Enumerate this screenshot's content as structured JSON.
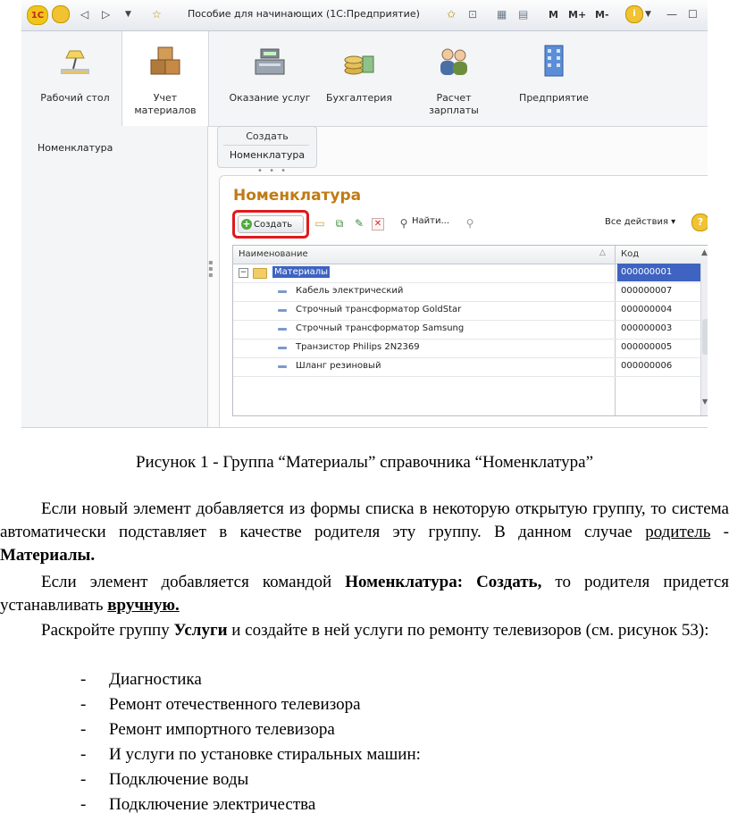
{
  "screenshot": {
    "window_title": "Пособие для начинающих (1С:Предприятие)",
    "logo_text": "1С",
    "memory_buttons": [
      "M",
      "M+",
      "M-"
    ],
    "sections": [
      {
        "label": "Рабочий стол",
        "icon": "desk-lamp-icon"
      },
      {
        "label": "Учет материалов",
        "icon": "boxes-icon"
      },
      {
        "label": "Оказание услуг",
        "icon": "cash-register-icon"
      },
      {
        "label": "Бухгалтерия",
        "icon": "coins-icon"
      },
      {
        "label": "Расчет зарплаты",
        "icon": "people-icon"
      },
      {
        "label": "Предприятие",
        "icon": "building-icon"
      }
    ],
    "left_nav": {
      "items": [
        "Номенклатура"
      ]
    },
    "actions_panel": {
      "header": "Создать",
      "item": "Номенклатура"
    },
    "form": {
      "title": "Номенклатура",
      "toolbar": {
        "create_label": "Создать",
        "find_label": "Найти...",
        "all_actions_label": "Все действия ▾"
      },
      "grid": {
        "columns": [
          "Наименование",
          "Код"
        ],
        "rows": [
          {
            "name": "Материалы",
            "code": "000000001",
            "type": "group",
            "selected": true
          },
          {
            "name": "Кабель электрический",
            "code": "000000007",
            "type": "item"
          },
          {
            "name": "Строчный трансформатор GoldStar",
            "code": "000000004",
            "type": "item"
          },
          {
            "name": "Строчный трансформатор Samsung",
            "code": "000000003",
            "type": "item"
          },
          {
            "name": "Транзистор Philips 2N2369",
            "code": "000000005",
            "type": "item"
          },
          {
            "name": "Шланг резиновый",
            "code": "000000006",
            "type": "item"
          }
        ]
      }
    },
    "colors": {
      "highlight_frame": "#e0191b",
      "selected_row": "#3e63c1",
      "form_title": "#c07b14"
    }
  },
  "document": {
    "caption": "Рисунок 1 - Группа “Материалы” справочника “Номенклатура”",
    "p1_text": "Если новый элемент добавляется из формы списка в некоторую открытую группу, то система автоматически подставляет в качестве родителя эту группу. В данном случае ",
    "p1_underlined": "родитель",
    "p1_dash": " - ",
    "p1_bold": "Материалы.",
    "p2_text": "Если элемент добавляется командой ",
    "p2_bold": "Номенклатура: Создать,",
    "p2_text2": " то родителя придется устанавливать ",
    "p2_bold_underlined": "вручную.",
    "p3_text": "Раскройте группу ",
    "p3_bold": "Услуги",
    "p3_text2": " и создайте в ней услуги по ремонту телевизоров (см. рисунок 53):",
    "list_items": [
      "Диагностика",
      "Ремонт отечественного телевизора",
      "Ремонт импортного телевизора",
      "И услуги по установке стиральных машин:",
      "Подключение воды",
      "Подключение электричества"
    ]
  }
}
